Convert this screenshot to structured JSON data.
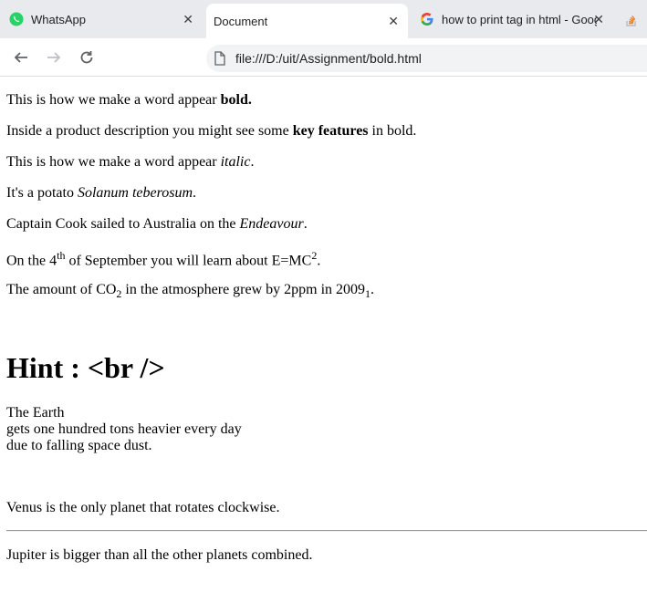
{
  "browser": {
    "tabs": [
      {
        "title": "WhatsApp",
        "icon": "whatsapp-icon",
        "active": false
      },
      {
        "title": "Document",
        "icon": "",
        "active": true
      },
      {
        "title": "how to print tag in html - Goog",
        "icon": "google-icon",
        "active": false
      }
    ],
    "url": "file:///D:/uit/Assignment/bold.html"
  },
  "page": {
    "line1": {
      "pre": "This is how we make a word appear ",
      "bold": "bold."
    },
    "line2": {
      "pre": "Inside a product description you might see some ",
      "bold": "key features",
      "post": " in bold."
    },
    "line3": {
      "pre": "This is how we make a word appear ",
      "italic": "italic",
      "post": "."
    },
    "line4": {
      "pre": "It's a potato ",
      "italic": "Solanum teberosum",
      "post": "."
    },
    "line5": {
      "pre": "Captain Cook sailed to Australia on the ",
      "italic": "Endeavour",
      "post": "."
    },
    "line6": {
      "pre": "On the 4",
      "sup1": "th",
      "mid": " of September you will learn about E=MC",
      "sup2": "2",
      "post": "."
    },
    "line7": {
      "pre": "The amount of CO",
      "sub1": "2",
      "mid": " in the atmosphere grew by 2ppm in 2009",
      "sub2": "1",
      "post": "."
    },
    "heading": "Hint : <br />",
    "earth_lines": [
      "The Earth",
      "gets one hundred tons heavier every day",
      "due to falling space dust."
    ],
    "venus": "Venus is the only planet that rotates clockwise.",
    "jupiter": "Jupiter is bigger than all the other planets combined."
  },
  "colors": {
    "whatsapp_green": "#25d366",
    "tabbar_bg": "#e8eaed",
    "omnibox_bg": "#f1f3f4"
  }
}
